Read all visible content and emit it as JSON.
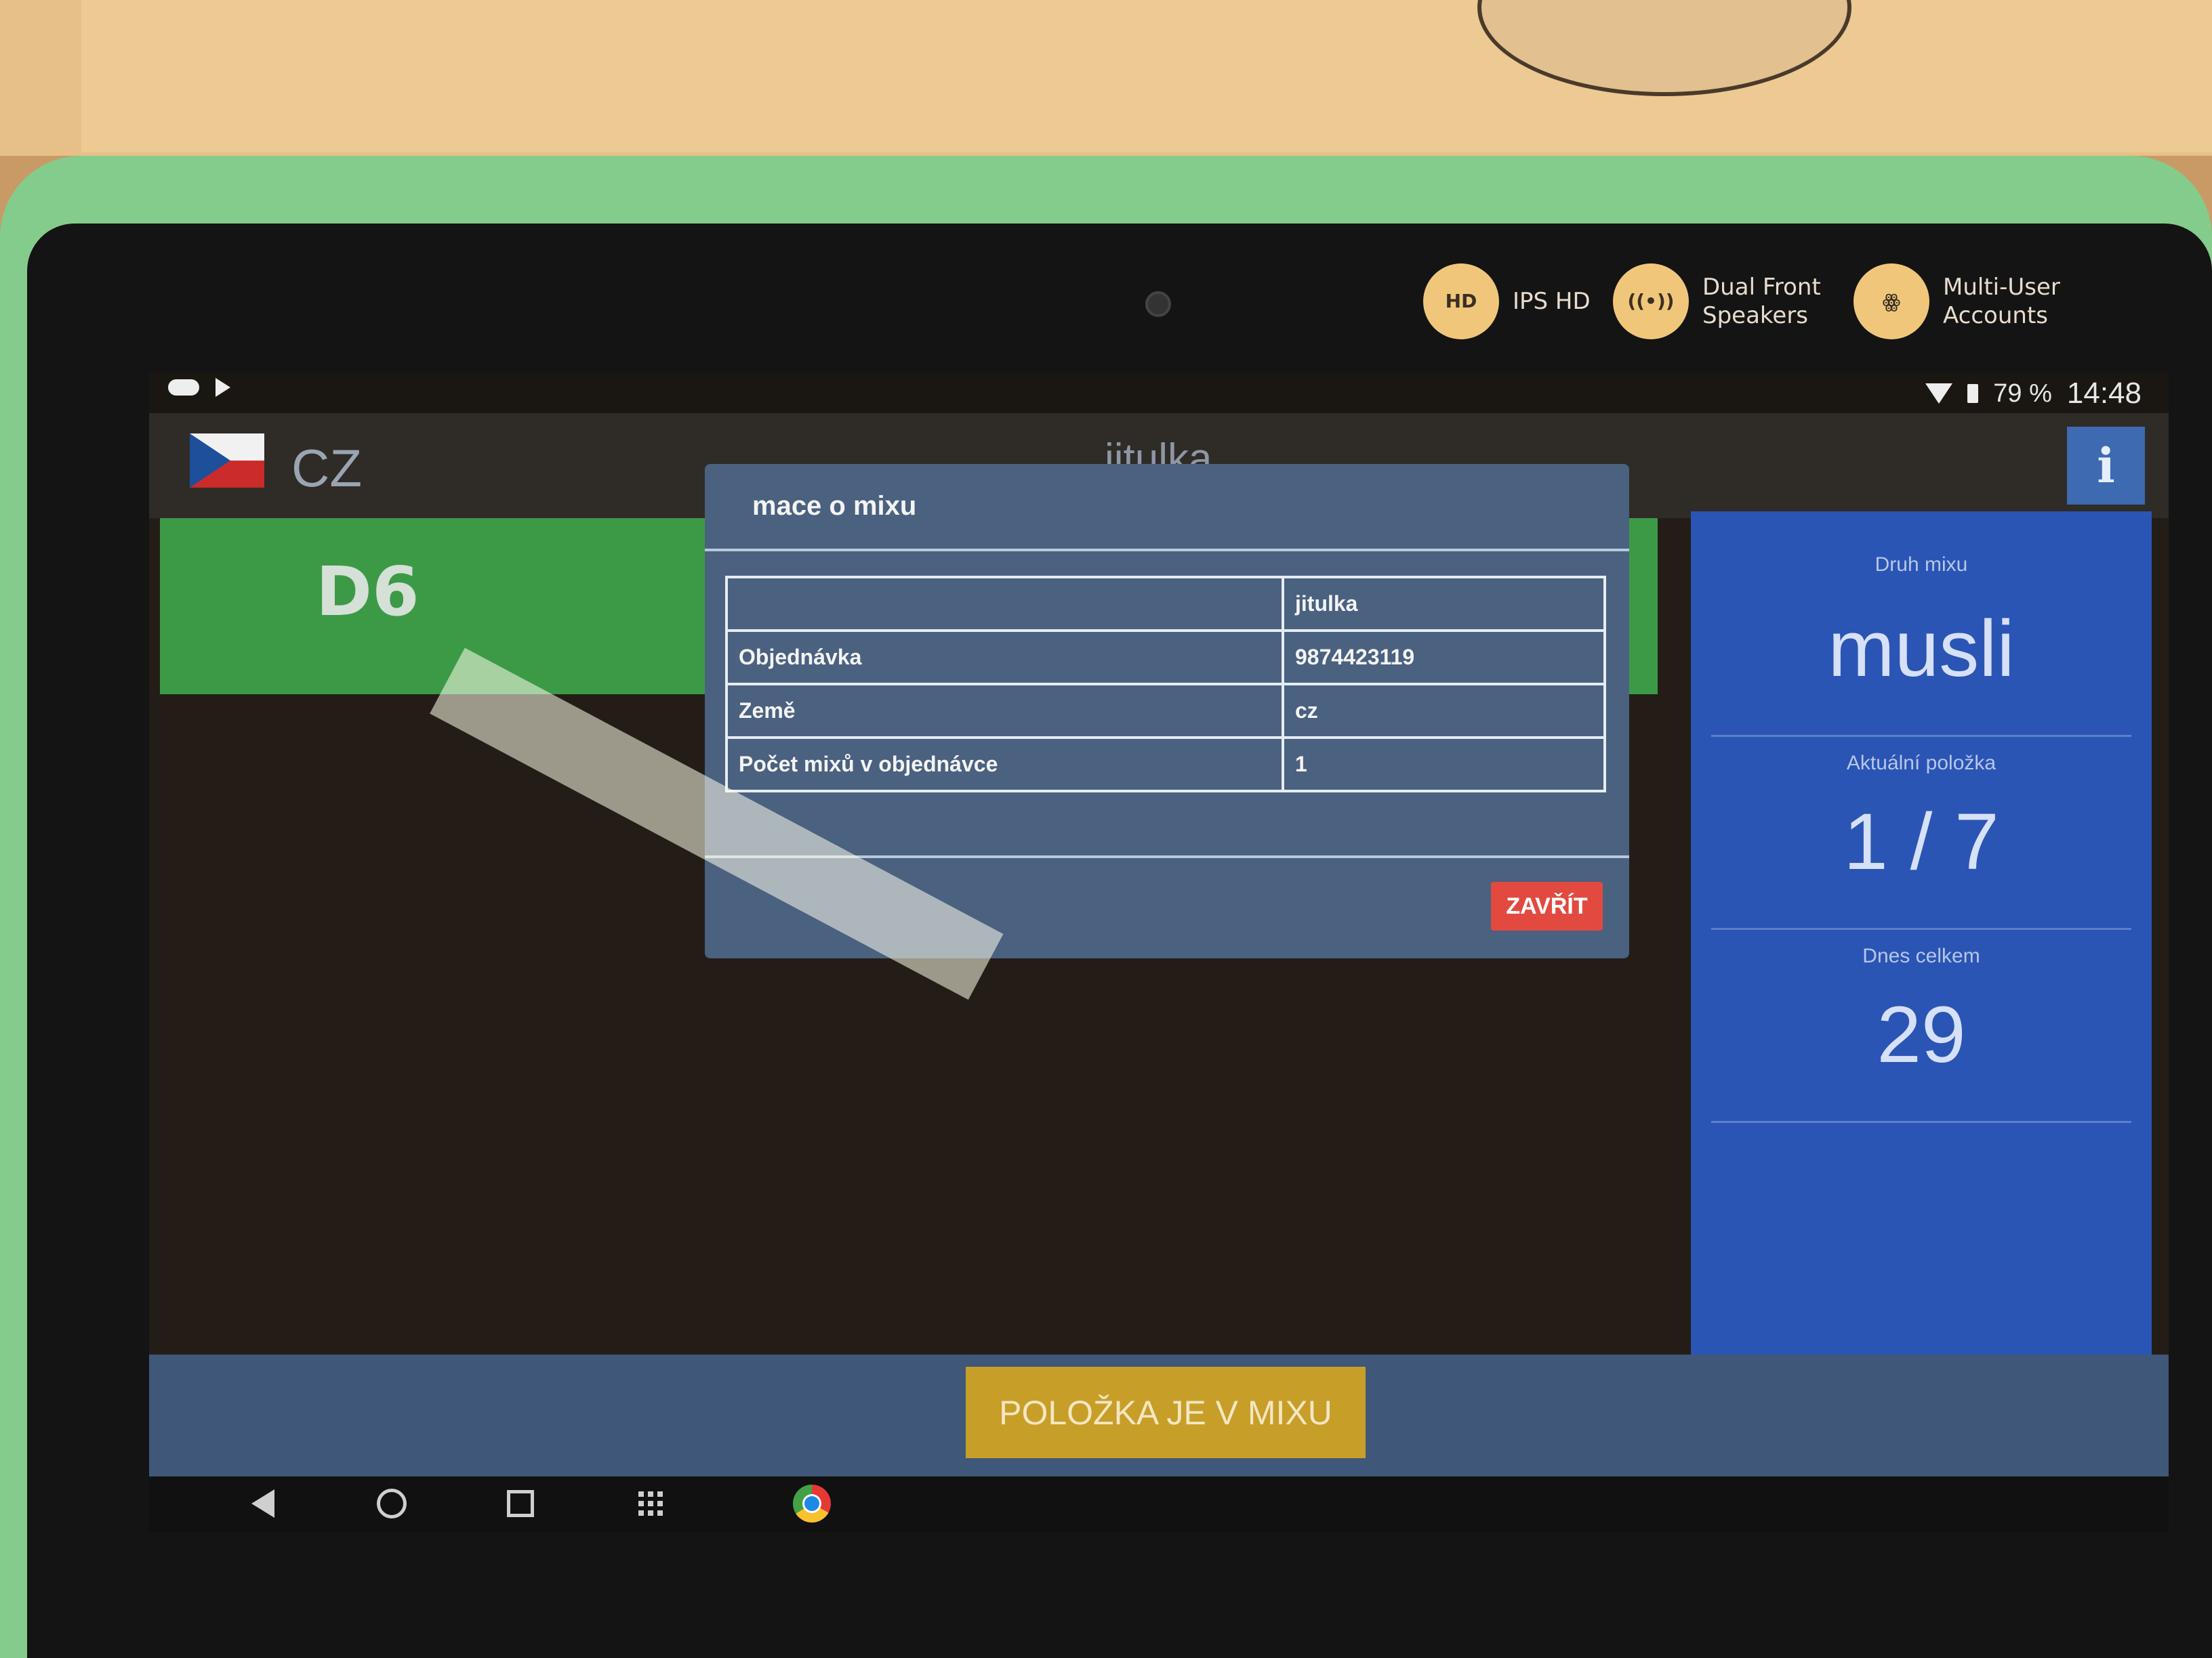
{
  "device": {
    "features": [
      {
        "icon": "hd-icon",
        "badge": "HD",
        "lines": [
          "IPS HD"
        ]
      },
      {
        "icon": "speaker-icon",
        "badge": "((•))",
        "lines": [
          "Dual Front",
          "Speakers"
        ]
      },
      {
        "icon": "multi-user-icon",
        "badge": "ꙮ",
        "lines": [
          "Multi-User",
          "Accounts"
        ]
      }
    ]
  },
  "statusbar": {
    "battery": "79 %",
    "time": "14:48"
  },
  "appbar": {
    "country": "CZ",
    "user": "jitulka",
    "info_label": "i"
  },
  "slot": {
    "label": "D6"
  },
  "stats": {
    "mix_type_caption": "Druh mixu",
    "mix_type_value": "musli",
    "current_item_caption": "Aktuální položka",
    "current_item_value": "1 / 7",
    "today_total_caption": "Dnes celkem",
    "today_total_value": "29"
  },
  "dialog": {
    "title": "mace o mixu",
    "rows": [
      {
        "label": "",
        "value": "jitulka"
      },
      {
        "label": "Objednávka",
        "value": "9874423119"
      },
      {
        "label": "Země",
        "value": "cz"
      },
      {
        "label": "Počet mixů v objednávce",
        "value": "1"
      }
    ],
    "close_label": "ZAVŘÍT"
  },
  "bottom": {
    "button_label": "POLOŽKA JE V MIXU"
  },
  "colors": {
    "case": "#84cc8b",
    "slot_green": "#3c9a47",
    "stats_blue": "#2a55b4",
    "close_red": "#e24a3f",
    "mix_button_yellow": "#c79e28"
  }
}
